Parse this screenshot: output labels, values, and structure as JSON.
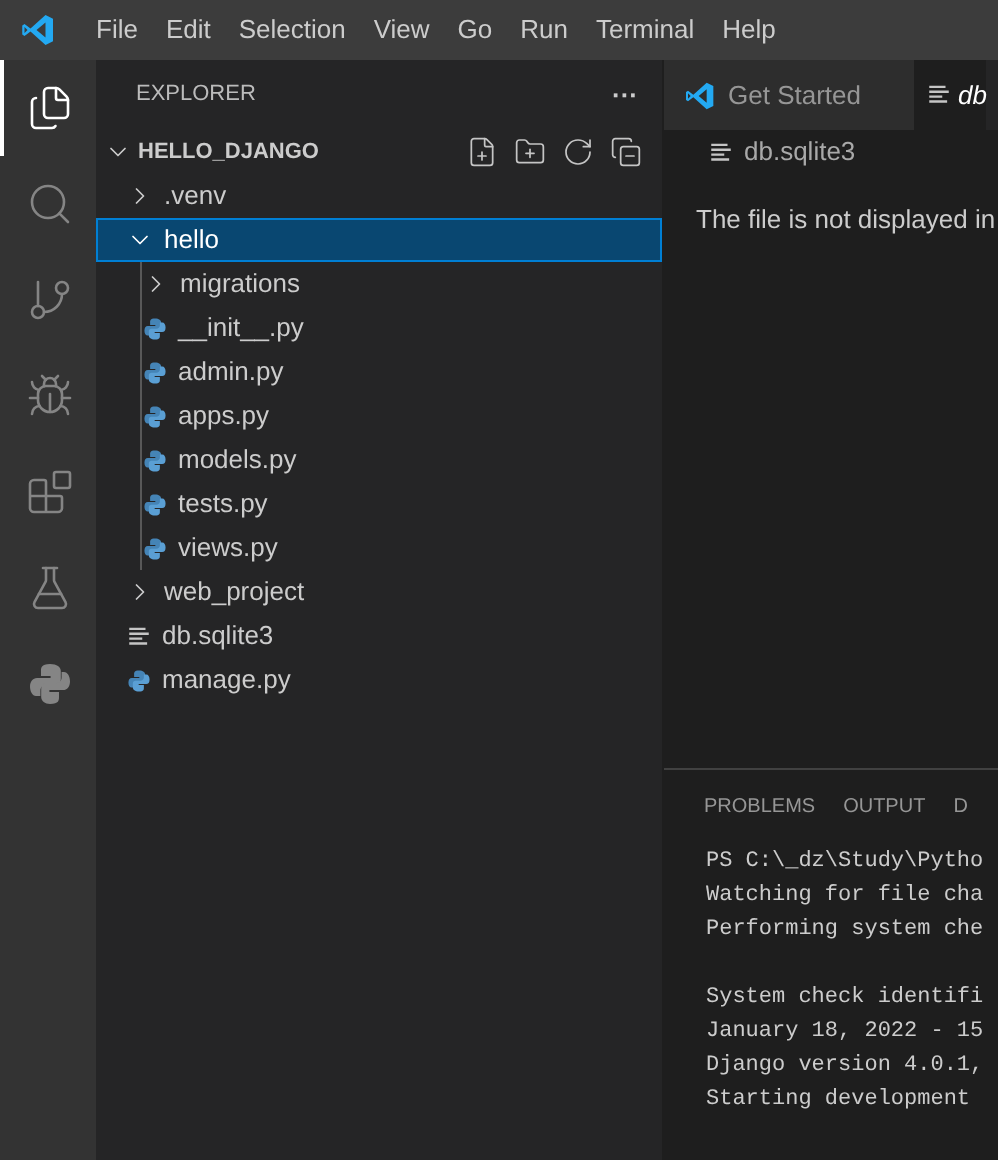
{
  "menu_bar": {
    "items": [
      "File",
      "Edit",
      "Selection",
      "View",
      "Go",
      "Run",
      "Terminal",
      "Help"
    ]
  },
  "activity_bar": {
    "items": [
      {
        "kind": "explorer",
        "selected": true
      },
      {
        "kind": "search",
        "selected": false
      },
      {
        "kind": "source-control",
        "selected": false
      },
      {
        "kind": "run-debug",
        "selected": false
      },
      {
        "kind": "extensions",
        "selected": false
      },
      {
        "kind": "testing",
        "selected": false
      },
      {
        "kind": "python",
        "selected": false
      }
    ]
  },
  "sidebar": {
    "title": "EXPLORER",
    "more": "···",
    "root": {
      "label": "HELLO_DJANGO",
      "expanded": true,
      "children": [
        {
          "label": ".venv",
          "kind": "folder",
          "expanded": false,
          "selected": false
        },
        {
          "label": "hello",
          "kind": "folder",
          "expanded": true,
          "selected": true,
          "children": [
            {
              "label": "migrations",
              "kind": "folder",
              "expanded": false,
              "selected": false
            },
            {
              "label": "__init__.py",
              "kind": "python",
              "selected": false
            },
            {
              "label": "admin.py",
              "kind": "python",
              "selected": false
            },
            {
              "label": "apps.py",
              "kind": "python",
              "selected": false
            },
            {
              "label": "models.py",
              "kind": "python",
              "selected": false
            },
            {
              "label": "tests.py",
              "kind": "python",
              "selected": false
            },
            {
              "label": "views.py",
              "kind": "python",
              "selected": false
            }
          ]
        },
        {
          "label": "web_project",
          "kind": "folder",
          "expanded": false,
          "selected": false
        },
        {
          "label": "db.sqlite3",
          "kind": "text",
          "selected": false
        },
        {
          "label": "manage.py",
          "kind": "python",
          "selected": false
        }
      ]
    }
  },
  "editor": {
    "tabs": [
      {
        "label": "Get Started",
        "kind": "welcome",
        "selected": false
      },
      {
        "label": "db",
        "kind": "text",
        "selected": true
      }
    ],
    "breadcrumb": "db.sqlite3",
    "message": "The file is not displayed in"
  },
  "panel": {
    "tabs": [
      {
        "label": "PROBLEMS",
        "selected": false
      },
      {
        "label": "OUTPUT",
        "selected": false
      },
      {
        "label": "D",
        "selected": false
      }
    ],
    "terminal_blocks": [
      [
        "PS C:\\_dz\\Study\\Pytho",
        "Watching for file cha",
        "Performing system che"
      ],
      [
        "System check identifi",
        "January 18, 2022 - 15",
        "Django version 4.0.1,",
        "Starting development"
      ]
    ]
  }
}
